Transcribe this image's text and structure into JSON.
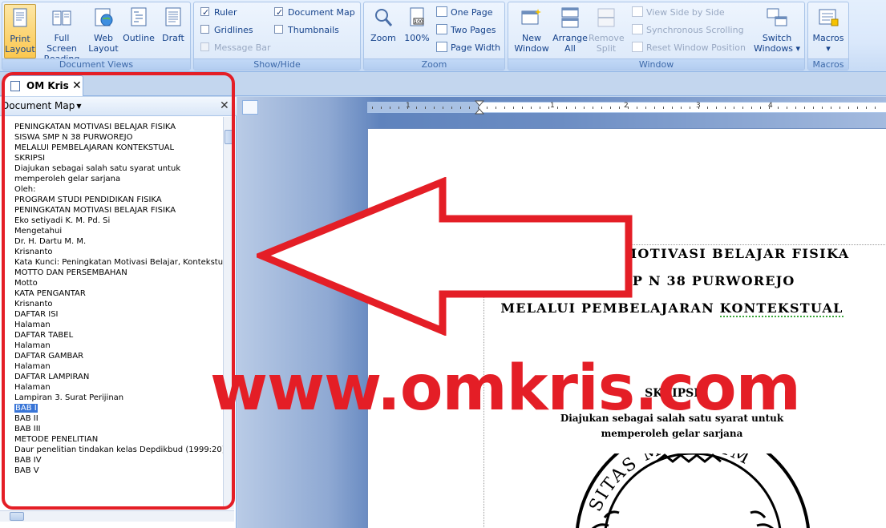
{
  "ribbon": {
    "document_views": {
      "label": "Document Views",
      "buttons": [
        {
          "line1": "Print",
          "line2": "Layout",
          "active": true
        },
        {
          "line1": "Full Screen",
          "line2": "Reading"
        },
        {
          "line1": "Web",
          "line2": "Layout"
        },
        {
          "line1": "Outline",
          "line2": ""
        },
        {
          "line1": "Draft",
          "line2": ""
        }
      ]
    },
    "show_hide": {
      "label": "Show/Hide",
      "ruler": "Ruler",
      "gridlines": "Gridlines",
      "message_bar": "Message Bar",
      "document_map": "Document Map",
      "thumbnails": "Thumbnails"
    },
    "zoom": {
      "label": "Zoom",
      "zoom_btn": "Zoom",
      "hundred_btn": "100%",
      "hundred_icon_text": "100",
      "one_page": "One Page",
      "two_pages": "Two Pages",
      "page_width": "Page Width"
    },
    "window": {
      "label": "Window",
      "new_window": {
        "line1": "New",
        "line2": "Window"
      },
      "arrange_all": {
        "line1": "Arrange",
        "line2": "All"
      },
      "remove_split": {
        "line1": "Remove",
        "line2": "Split"
      },
      "view_side_by_side": "View Side by Side",
      "sync_scrolling": "Synchronous Scrolling",
      "reset_position": "Reset Window Position",
      "switch_windows": {
        "line1": "Switch",
        "line2": "Windows ▾"
      }
    },
    "macros": {
      "label": "Macros",
      "macros_btn": {
        "line1": "Macros",
        "line2": "▾"
      }
    }
  },
  "tab": {
    "title": "OM Kris",
    "close": "✕"
  },
  "docmap": {
    "title": "Document Map",
    "dropdown": "▼",
    "close": "✕",
    "items": [
      "PENINGKATAN MOTIVASI BELAJAR FISIKA",
      "SISWA SMP N 38 PURWOREJO",
      "MELALUI  PEMBELAJARAN KONTEKSTUAL",
      "SKRIPSI",
      "Diajukan sebagai salah satu syarat untuk",
      "memperoleh gelar sarjana",
      "Oleh:",
      "PROGRAM STUDI PENDIDIKAN FISIKA",
      "PENINGKATAN MOTIVASI BELAJAR FISIKA",
      "Eko setiyadi K. M. Pd. Si",
      "Mengetahui",
      "Dr. H. Dartu M. M.",
      "Krisnanto",
      "Kata Kunci: Peningkatan Motivasi Belajar, Kontekstual",
      "MOTTO DAN PERSEMBAHAN",
      "Motto",
      "KATA PENGANTAR",
      "Krisnanto",
      "DAFTAR ISI",
      "Halaman",
      "DAFTAR TABEL",
      "Halaman",
      "DAFTAR GAMBAR",
      "Halaman",
      "DAFTAR LAMPIRAN",
      "Halaman",
      "Lampiran 3.  Surat Perijinan",
      "BAB I",
      "BAB II",
      "BAB III",
      "METODE PENELITIAN",
      "Daur penelitian tindakan kelas Depdikbud (1999:20)",
      "BAB IV",
      "BAB V"
    ],
    "selected_index": 27
  },
  "ruler": {
    "numbers": [
      "1",
      "1",
      "2",
      "3",
      "4"
    ]
  },
  "document": {
    "title_line1": "PENINGKATAN MOTIVASI BELAJAR FISIKA",
    "title_line2": "SISWA SMP N 38 PURWOREJO",
    "title_line3_a": "MELALUI  PEMBELAJARAN ",
    "title_line3_b": "KONTEKSTUAL",
    "skripsi": "SKRIPSI",
    "subtitle_line1": "Diajukan sebagai salah satu syarat untuk",
    "subtitle_line2": "memperoleh gelar sarjana",
    "seal_text": "SITAS MUHAMM"
  },
  "overlay": {
    "watermark": "www.omkris.com",
    "colors": {
      "accent": "#e41e26",
      "selection": "#3875d7",
      "ribbon": "#dae8fb"
    }
  }
}
